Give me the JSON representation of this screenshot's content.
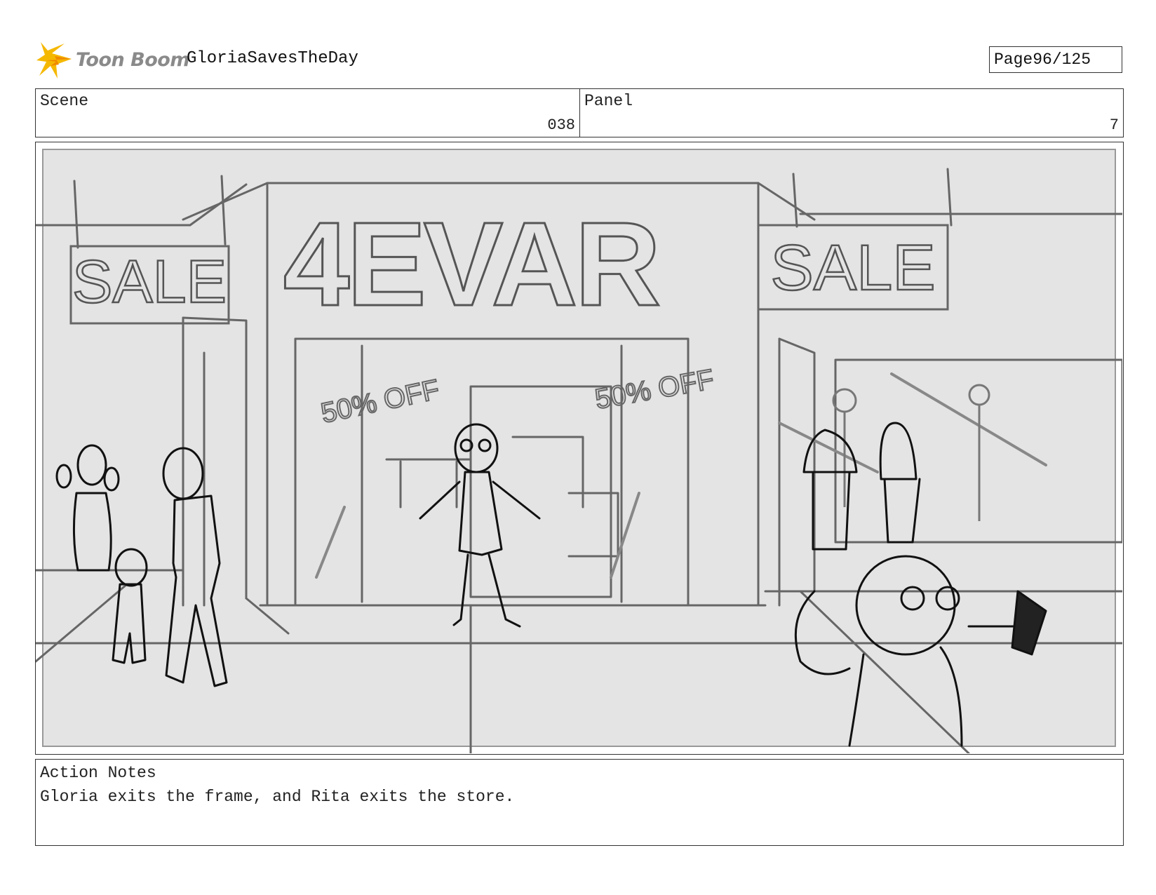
{
  "header": {
    "logo_text": "Toon Boom",
    "project_title": "GloriaSavesTheDay",
    "page_label": "Page",
    "page_value": "96/125"
  },
  "scene": {
    "label": "Scene",
    "value": "038"
  },
  "panel": {
    "label": "Panel",
    "value": "7"
  },
  "frame": {
    "sign_left": "SALE",
    "store_sign": "4EVAR",
    "sign_right": "SALE",
    "window_left_sticker": "50% OFF",
    "window_right_sticker": "50% OFF"
  },
  "action_notes": {
    "label": "Action Notes",
    "text": "Gloria exits the frame, and Rita exits the store."
  },
  "colors": {
    "logo_yellow": "#f5b800",
    "logo_orange": "#f08a00",
    "sketch": "#555555",
    "ink": "#111111",
    "frame_bg": "#e4e4e4"
  }
}
